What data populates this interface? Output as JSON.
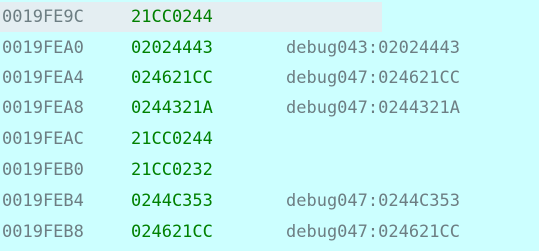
{
  "stack": {
    "rows": [
      {
        "address": "0019FE9C",
        "value": "21CC0244",
        "comment": "",
        "selected": true
      },
      {
        "address": "0019FEA0",
        "value": "02024443",
        "comment": "debug043:02024443",
        "selected": false
      },
      {
        "address": "0019FEA4",
        "value": "024621CC",
        "comment": "debug047:024621CC",
        "selected": false
      },
      {
        "address": "0019FEA8",
        "value": "0244321A",
        "comment": "debug047:0244321A",
        "selected": false
      },
      {
        "address": "0019FEAC",
        "value": "21CC0244",
        "comment": "",
        "selected": false
      },
      {
        "address": "0019FEB0",
        "value": "21CC0232",
        "comment": "",
        "selected": false
      },
      {
        "address": "0019FEB4",
        "value": "0244C353",
        "comment": "debug047:0244C353",
        "selected": false
      },
      {
        "address": "0019FEB8",
        "value": "024621CC",
        "comment": "debug047:024621CC",
        "selected": false
      }
    ]
  },
  "colors": {
    "background": "#ccffff",
    "selection": "#e4eef2",
    "address_text": "#6d7e83",
    "value_text": "#008000",
    "comment_text": "#6d7e83"
  }
}
